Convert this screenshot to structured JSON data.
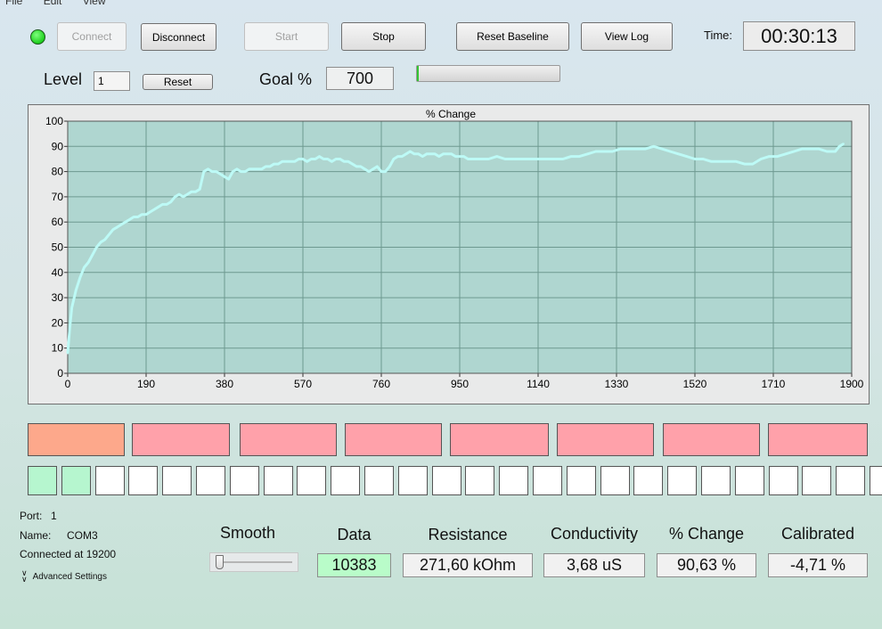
{
  "menu": {
    "items": [
      "File",
      "Edit",
      "View"
    ]
  },
  "toolbar": {
    "connect_label": "Connect",
    "disconnect_label": "Disconnect",
    "start_label": "Start",
    "stop_label": "Stop",
    "reset_baseline_label": "Reset Baseline",
    "view_log_label": "View Log",
    "time_label": "Time:",
    "time_value": "00:30:13",
    "status_led_color": "#1fcf1f"
  },
  "level": {
    "label": "Level",
    "value": "1",
    "reset_label": "Reset",
    "goal_label": "Goal %",
    "goal_value": "700",
    "progress_fraction": 0.0
  },
  "chart_data": {
    "type": "line",
    "title": "% Change",
    "xlabel": "",
    "ylabel": "",
    "xlim": [
      0,
      1900
    ],
    "ylim": [
      0,
      100
    ],
    "x_ticks": [
      "0",
      "190",
      "380",
      "570",
      "760",
      "950",
      "1140",
      "1330",
      "1520",
      "1710",
      "1900"
    ],
    "y_ticks": [
      "0",
      "10",
      "20",
      "30",
      "40",
      "50",
      "60",
      "70",
      "80",
      "90",
      "100"
    ],
    "grid": true,
    "plot_bg": "#afd6d0",
    "line_color": "#bdfaf6",
    "series": [
      {
        "x": [
          0,
          5,
          10,
          20,
          30,
          40,
          50,
          60,
          70,
          80,
          90,
          100,
          110,
          120,
          130,
          140,
          150,
          160,
          170,
          180,
          190,
          200,
          210,
          220,
          230,
          240,
          250,
          260,
          270,
          280,
          290,
          300,
          310,
          320,
          330,
          340,
          350,
          360,
          370,
          380,
          390,
          400,
          410,
          420,
          430,
          440,
          450,
          460,
          470,
          480,
          490,
          500,
          510,
          520,
          530,
          540,
          550,
          560,
          570,
          580,
          590,
          600,
          610,
          620,
          630,
          640,
          650,
          660,
          670,
          680,
          690,
          700,
          710,
          720,
          730,
          740,
          750,
          760,
          770,
          780,
          790,
          800,
          810,
          820,
          830,
          840,
          850,
          860,
          870,
          880,
          890,
          900,
          910,
          920,
          930,
          940,
          950,
          960,
          970,
          980,
          990,
          1000,
          1020,
          1040,
          1060,
          1080,
          1100,
          1120,
          1140,
          1160,
          1180,
          1200,
          1220,
          1240,
          1260,
          1280,
          1300,
          1320,
          1340,
          1360,
          1380,
          1400,
          1420,
          1440,
          1460,
          1480,
          1500,
          1520,
          1540,
          1560,
          1580,
          1600,
          1620,
          1640,
          1660,
          1680,
          1700,
          1720,
          1740,
          1760,
          1780,
          1800,
          1820,
          1840,
          1860,
          1870,
          1880
        ],
        "y": [
          8,
          18,
          26,
          33,
          38,
          42,
          44,
          47,
          50,
          52,
          53,
          55,
          57,
          58,
          59,
          60,
          61,
          62,
          62,
          63,
          63,
          64,
          65,
          66,
          67,
          67,
          68,
          70,
          71,
          70,
          71,
          72,
          72,
          73,
          80,
          81,
          80,
          80,
          79,
          78,
          77,
          80,
          81,
          80,
          80,
          81,
          81,
          81,
          81,
          82,
          82,
          83,
          83,
          84,
          84,
          84,
          84,
          85,
          85,
          84,
          85,
          85,
          86,
          85,
          85,
          84,
          85,
          85,
          84,
          84,
          83,
          82,
          82,
          81,
          80,
          81,
          82,
          80,
          80,
          82,
          85,
          86,
          86,
          87,
          88,
          87,
          87,
          86,
          87,
          87,
          87,
          86,
          87,
          87,
          87,
          86,
          86,
          86,
          85,
          85,
          85,
          85,
          85,
          86,
          85,
          85,
          85,
          85,
          85,
          85,
          85,
          85,
          86,
          86,
          87,
          88,
          88,
          88,
          89,
          89,
          89,
          89,
          90,
          89,
          88,
          87,
          86,
          85,
          85,
          84,
          84,
          84,
          84,
          83,
          83,
          85,
          86,
          86,
          87,
          88,
          89,
          89,
          89,
          88,
          88,
          90,
          91
        ]
      }
    ]
  },
  "indicators": {
    "bar_colors": [
      "#fda88b",
      "#ffa1aa",
      "#ffa1aa",
      "#ffa1aa",
      "#ffa1aa",
      "#ffa1aa",
      "#ffa1aa",
      "#ffa1aa"
    ],
    "squares_on": [
      true,
      true,
      false,
      false,
      false,
      false,
      false,
      false,
      false,
      false,
      false,
      false,
      false,
      false,
      false,
      false,
      false,
      false,
      false,
      false,
      false,
      false,
      false,
      false,
      false,
      false
    ]
  },
  "port": {
    "port_label": "Port:",
    "port_value": "1",
    "name_label": "Name:",
    "name_value": "COM3",
    "connected_text": "Connected at 19200",
    "advanced_label": "Advanced Settings"
  },
  "readouts": {
    "smooth_label": "Smooth",
    "smooth_level": 0.0,
    "data_label": "Data",
    "data_value": "10383",
    "resistance_label": "Resistance",
    "resistance_value": "271,60 kOhm",
    "conductivity_label": "Conductivity",
    "conductivity_value": "3,68 uS",
    "change_label": "% Change",
    "change_value": "90,63 %",
    "calibrated_label": "Calibrated",
    "calibrated_value": "-4,71 %"
  }
}
